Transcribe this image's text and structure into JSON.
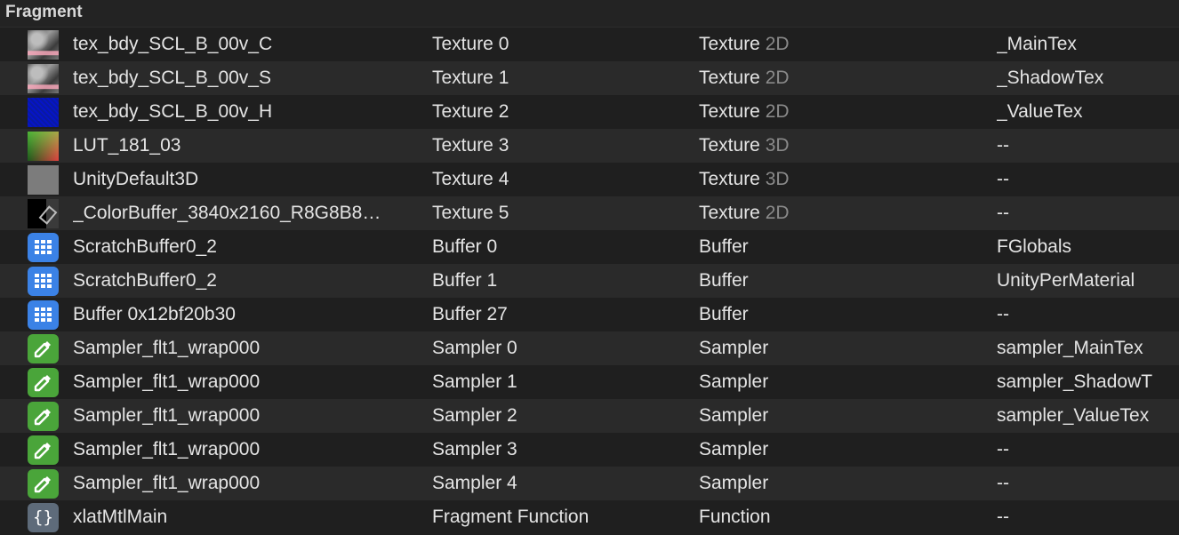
{
  "section": {
    "title": "Fragment"
  },
  "rows": [
    {
      "icon": "texture-thumbnail-icon",
      "name": "tex_bdy_SCL_B_00v_C",
      "slot": "Texture 0",
      "type": "Texture",
      "dim": "2D",
      "binding": "_MainTex"
    },
    {
      "icon": "texture-thumbnail-icon",
      "name": "tex_bdy_SCL_B_00v_S",
      "slot": "Texture 1",
      "type": "Texture",
      "dim": "2D",
      "binding": "_ShadowTex"
    },
    {
      "icon": "texture-thumbnail-icon",
      "name": "tex_bdy_SCL_B_00v_H",
      "slot": "Texture 2",
      "type": "Texture",
      "dim": "2D",
      "binding": "_ValueTex"
    },
    {
      "icon": "lut-thumbnail-icon",
      "name": "LUT_181_03",
      "slot": "Texture 3",
      "type": "Texture",
      "dim": "3D",
      "binding": "--"
    },
    {
      "icon": "gray-texture-thumbnail-icon",
      "name": "UnityDefault3D",
      "slot": "Texture 4",
      "type": "Texture",
      "dim": "3D",
      "binding": "--"
    },
    {
      "icon": "colorbuffer-thumbnail-icon",
      "name": "_ColorBuffer_3840x2160_R8G8B8…",
      "slot": "Texture 5",
      "type": "Texture",
      "dim": "2D",
      "binding": "--"
    },
    {
      "icon": "buffer-icon",
      "name": "ScratchBuffer0_2",
      "slot": "Buffer 0",
      "type": "Buffer",
      "dim": "",
      "binding": "FGlobals"
    },
    {
      "icon": "buffer-icon",
      "name": "ScratchBuffer0_2",
      "slot": "Buffer 1",
      "type": "Buffer",
      "dim": "",
      "binding": "UnityPerMaterial"
    },
    {
      "icon": "buffer-icon",
      "name": "Buffer 0x12bf20b30",
      "slot": "Buffer 27",
      "type": "Buffer",
      "dim": "",
      "binding": "--"
    },
    {
      "icon": "sampler-eyedropper-icon",
      "name": "Sampler_flt1_wrap000",
      "slot": "Sampler 0",
      "type": "Sampler",
      "dim": "",
      "binding": "sampler_MainTex"
    },
    {
      "icon": "sampler-eyedropper-icon",
      "name": "Sampler_flt1_wrap000",
      "slot": "Sampler 1",
      "type": "Sampler",
      "dim": "",
      "binding": "sampler_ShadowT"
    },
    {
      "icon": "sampler-eyedropper-icon",
      "name": "Sampler_flt1_wrap000",
      "slot": "Sampler 2",
      "type": "Sampler",
      "dim": "",
      "binding": "sampler_ValueTex"
    },
    {
      "icon": "sampler-eyedropper-icon",
      "name": "Sampler_flt1_wrap000",
      "slot": "Sampler 3",
      "type": "Sampler",
      "dim": "",
      "binding": "--"
    },
    {
      "icon": "sampler-eyedropper-icon",
      "name": "Sampler_flt1_wrap000",
      "slot": "Sampler 4",
      "type": "Sampler",
      "dim": "",
      "binding": "--"
    },
    {
      "icon": "function-braces-icon",
      "name": "xlatMtlMain",
      "slot": "Fragment Function",
      "type": "Function",
      "dim": "",
      "binding": "--"
    }
  ],
  "colors": {
    "background": "#1e1e1e",
    "row_alt": "#2a2a2a",
    "buffer_icon": "#3b82e6",
    "sampler_icon": "#4aa53a",
    "function_icon": "#5e6b7a",
    "dim_text": "#8a8a8a"
  }
}
